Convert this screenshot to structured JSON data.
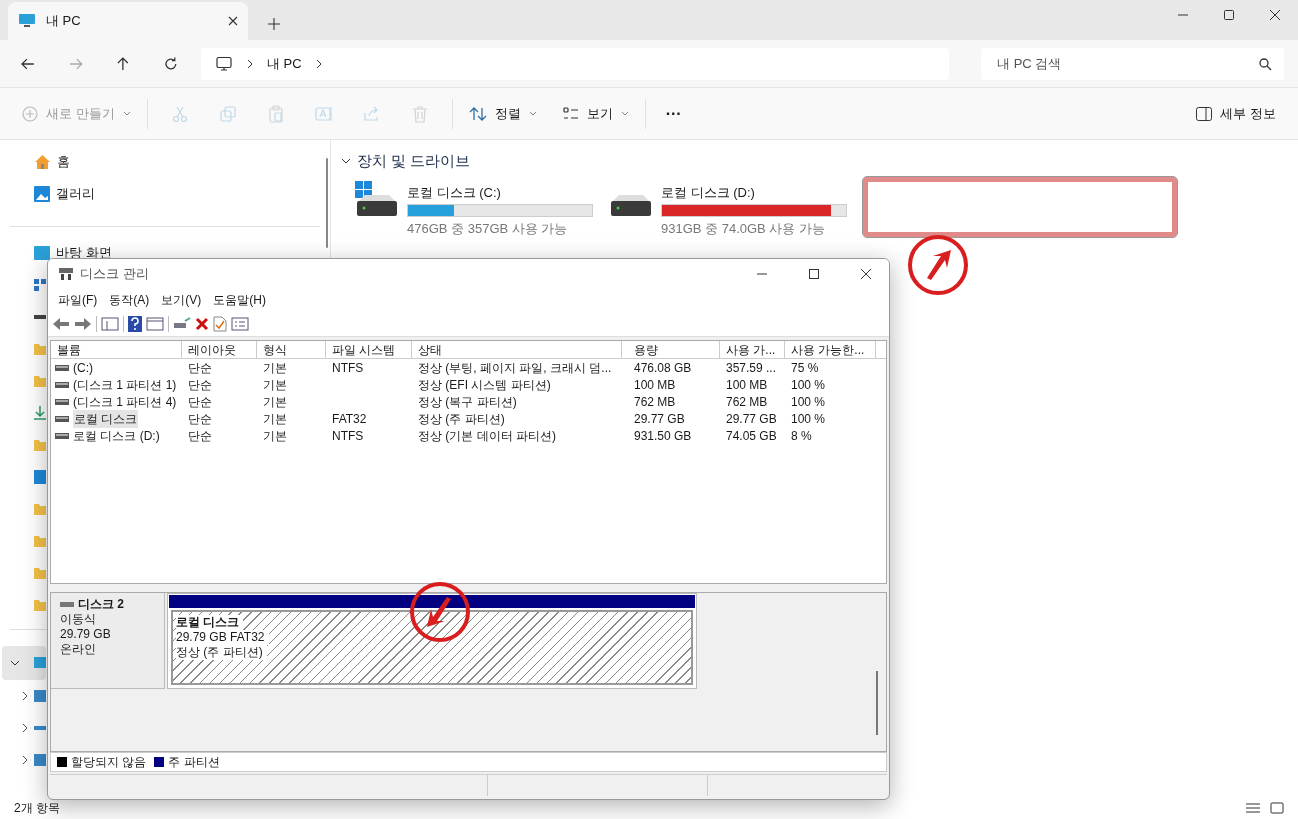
{
  "explorer": {
    "tab": {
      "title": "내 PC"
    },
    "breadcrumb": [
      "내 PC"
    ],
    "search": {
      "placeholder": "내 PC 검색"
    },
    "commands": [
      {
        "label": "새로 만들기",
        "kind": "new",
        "disabled": true
      },
      {
        "kind": "cut",
        "disabled": true
      },
      {
        "kind": "copy",
        "disabled": true
      },
      {
        "kind": "paste",
        "disabled": true
      },
      {
        "kind": "rename",
        "disabled": true
      },
      {
        "kind": "share",
        "disabled": true
      },
      {
        "kind": "delete",
        "disabled": true
      },
      {
        "label": "정렬",
        "kind": "sort",
        "disabled": false
      },
      {
        "label": "보기",
        "kind": "view",
        "disabled": false
      },
      {
        "label": "···",
        "kind": "more",
        "disabled": false
      }
    ],
    "details_button": "세부 정보",
    "sidebar": {
      "items": [
        {
          "label": "홈",
          "kind": "home"
        },
        {
          "label": "갤러리",
          "kind": "gallery"
        }
      ],
      "covered_label": "바탕 화면"
    },
    "section": {
      "title": "장치 및 드라이브",
      "expanded": true
    },
    "drives": [
      {
        "name": "로컬 디스크 (C:)",
        "kind": "system",
        "level": 0.25,
        "color": "#26a0da",
        "info": "476GB 중 357GB 사용 가능"
      },
      {
        "name": "로컬 디스크 (D:)",
        "kind": "data",
        "level": 0.92,
        "color": "#da2626",
        "info": "931GB 중 74.0GB 사용 가능"
      }
    ],
    "status_bar": "2개 항목"
  },
  "disk_management": {
    "title": "디스크 관리",
    "menu": [
      "파일(F)",
      "동작(A)",
      "보기(V)",
      "도움말(H)"
    ],
    "columns": [
      "볼륨",
      "레이아웃",
      "형식",
      "파일 시스템",
      "상태",
      "용량",
      "사용 가...",
      "사용 가능한..."
    ],
    "rows": [
      {
        "cells": [
          " (C:)",
          "단순",
          "기본",
          "NTFS",
          "정상 (부팅, 페이지 파일, 크래시 덤...",
          "476.08 GB",
          "357.59 ...",
          "75 %"
        ],
        "selected": false
      },
      {
        "cells": [
          "(디스크 1 파티션 1)",
          "단순",
          "기본",
          "",
          "정상 (EFI 시스템 파티션)",
          "100 MB",
          "100 MB",
          "100 %"
        ],
        "selected": false
      },
      {
        "cells": [
          "(디스크 1 파티션 4)",
          "단순",
          "기본",
          "",
          "정상 (복구 파티션)",
          "762 MB",
          "762 MB",
          "100 %"
        ],
        "selected": false
      },
      {
        "cells": [
          "로컬 디스크",
          "단순",
          "기본",
          "FAT32",
          "정상 (주 파티션)",
          "29.77 GB",
          "29.77 GB",
          "100 %"
        ],
        "selected": true
      },
      {
        "cells": [
          "로컬 디스크 (D:)",
          "단순",
          "기본",
          "NTFS",
          "정상 (기본 데이터 파티션)",
          "931.50 GB",
          "74.05 GB",
          "8 %"
        ],
        "selected": false
      }
    ],
    "disk": {
      "name": "디스크 2",
      "type": "이동식",
      "size": "29.79 GB",
      "status": "온라인",
      "partition": {
        "name": "로컬 디스크",
        "size": "29.79 GB FAT32",
        "status": "정상 (주 파티션)",
        "color": "#000080"
      }
    },
    "legend": [
      {
        "label": "할당되지 않음",
        "color": "#000000"
      },
      {
        "label": "주 파티션",
        "color": "#000080"
      }
    ]
  }
}
